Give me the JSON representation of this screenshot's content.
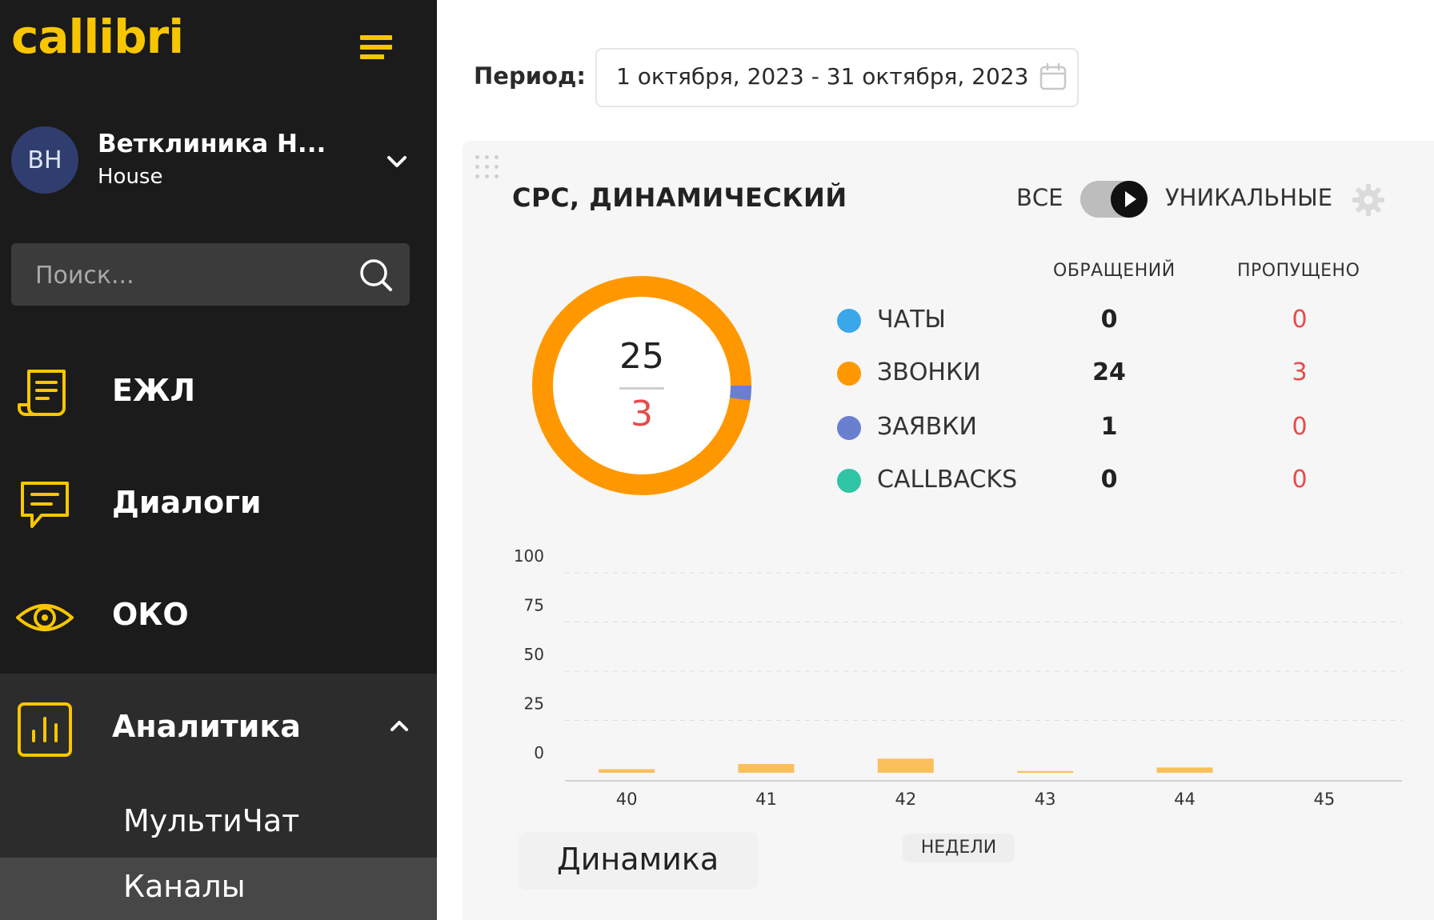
{
  "sidebar": {
    "logo": "callibri",
    "account": {
      "initials": "ВН",
      "name": "Ветклиника Н...",
      "subtitle": "House"
    },
    "search": {
      "placeholder": "Поиск..."
    },
    "nav": [
      {
        "label": "ЕЖЛ",
        "icon": "journal-icon"
      },
      {
        "label": "Диалоги",
        "icon": "chat-bubble-icon"
      },
      {
        "label": "ОКО",
        "icon": "eye-icon"
      },
      {
        "label": "Аналитика",
        "icon": "bar-chart-icon",
        "expanded": true
      }
    ],
    "submenu": [
      {
        "label": "МультиЧат"
      },
      {
        "label": "Каналы",
        "selected": true
      }
    ]
  },
  "period": {
    "label": "Период:",
    "value": "1 октября, 2023 - 31 октября, 2023"
  },
  "widget": {
    "title": "CPC, ДИНАМИЧЕСКИЙ",
    "toggle": {
      "left": "ВСЕ",
      "right": "УНИКАЛЬНЫЕ",
      "state": "right"
    },
    "columns": {
      "requests": "ОБРАЩЕНИЙ",
      "missed": "ПРОПУЩЕНО"
    },
    "donut": {
      "total": "25",
      "missed": "3"
    },
    "legend": [
      {
        "name": "ЧАТЫ",
        "requests": "0",
        "missed": "0",
        "color": "#3aa7ea"
      },
      {
        "name": "ЗВОНКИ",
        "requests": "24",
        "missed": "3",
        "color": "#ff9800"
      },
      {
        "name": "ЗАЯВКИ",
        "requests": "1",
        "missed": "0",
        "color": "#6b7fd1"
      },
      {
        "name": "CALLBACKS",
        "requests": "0",
        "missed": "0",
        "color": "#2fc4a4"
      }
    ],
    "tab_label": "Динамика",
    "xlabel": "НЕДЕЛИ"
  },
  "chart_data": {
    "type": "bar",
    "categories": [
      "40",
      "41",
      "42",
      "43",
      "44",
      "45"
    ],
    "values": [
      2,
      5,
      8,
      1,
      3,
      0
    ],
    "ylim": [
      0,
      100
    ],
    "yticks": [
      "100",
      "75",
      "50",
      "25",
      "0"
    ],
    "xlabel": "НЕДЕЛИ",
    "grid": true,
    "bar_color": "#fbbf5b"
  }
}
